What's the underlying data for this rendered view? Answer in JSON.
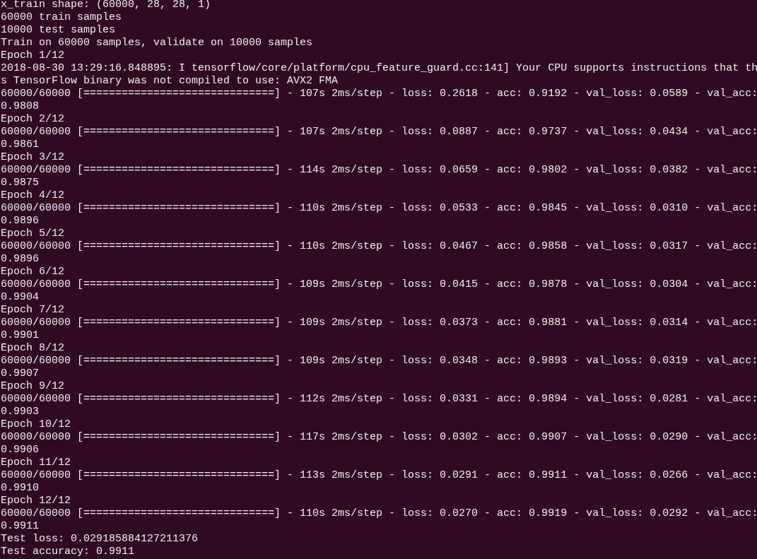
{
  "terminal": {
    "lines": [
      "x_train shape: (60000, 28, 28, 1)",
      "60000 train samples",
      "10000 test samples",
      "Train on 60000 samples, validate on 10000 samples",
      "Epoch 1/12",
      "2018-08-30 13:29:16.848895: I tensorflow/core/platform/cpu_feature_guard.cc:141] Your CPU supports instructions that th",
      "s TensorFlow binary was not compiled to use: AVX2 FMA",
      "60000/60000 [==============================] - 107s 2ms/step - loss: 0.2618 - acc: 0.9192 - val_loss: 0.0589 - val_acc:",
      "0.9808",
      "Epoch 2/12",
      "60000/60000 [==============================] - 107s 2ms/step - loss: 0.0887 - acc: 0.9737 - val_loss: 0.0434 - val_acc:",
      "0.9861",
      "Epoch 3/12",
      "60000/60000 [==============================] - 114s 2ms/step - loss: 0.0659 - acc: 0.9802 - val_loss: 0.0382 - val_acc:",
      "0.9875",
      "Epoch 4/12",
      "60000/60000 [==============================] - 110s 2ms/step - loss: 0.0533 - acc: 0.9845 - val_loss: 0.0310 - val_acc:",
      "0.9896",
      "Epoch 5/12",
      "60000/60000 [==============================] - 110s 2ms/step - loss: 0.0467 - acc: 0.9858 - val_loss: 0.0317 - val_acc:",
      "0.9896",
      "Epoch 6/12",
      "60000/60000 [==============================] - 109s 2ms/step - loss: 0.0415 - acc: 0.9878 - val_loss: 0.0304 - val_acc:",
      "0.9904",
      "Epoch 7/12",
      "60000/60000 [==============================] - 109s 2ms/step - loss: 0.0373 - acc: 0.9881 - val_loss: 0.0314 - val_acc:",
      "0.9901",
      "Epoch 8/12",
      "60000/60000 [==============================] - 109s 2ms/step - loss: 0.0348 - acc: 0.9893 - val_loss: 0.0319 - val_acc:",
      "0.9907",
      "Epoch 9/12",
      "60000/60000 [==============================] - 112s 2ms/step - loss: 0.0331 - acc: 0.9894 - val_loss: 0.0281 - val_acc:",
      "0.9903",
      "Epoch 10/12",
      "60000/60000 [==============================] - 117s 2ms/step - loss: 0.0302 - acc: 0.9907 - val_loss: 0.0290 - val_acc:",
      "0.9906",
      "Epoch 11/12",
      "60000/60000 [==============================] - 113s 2ms/step - loss: 0.0291 - acc: 0.9911 - val_loss: 0.0266 - val_acc:",
      "0.9910",
      "Epoch 12/12",
      "60000/60000 [==============================] - 110s 2ms/step - loss: 0.0270 - acc: 0.9919 - val_loss: 0.0292 - val_acc:",
      "0.9911",
      "Test loss: 0.029185884127211376",
      "Test accuracy: 0.9911"
    ]
  }
}
